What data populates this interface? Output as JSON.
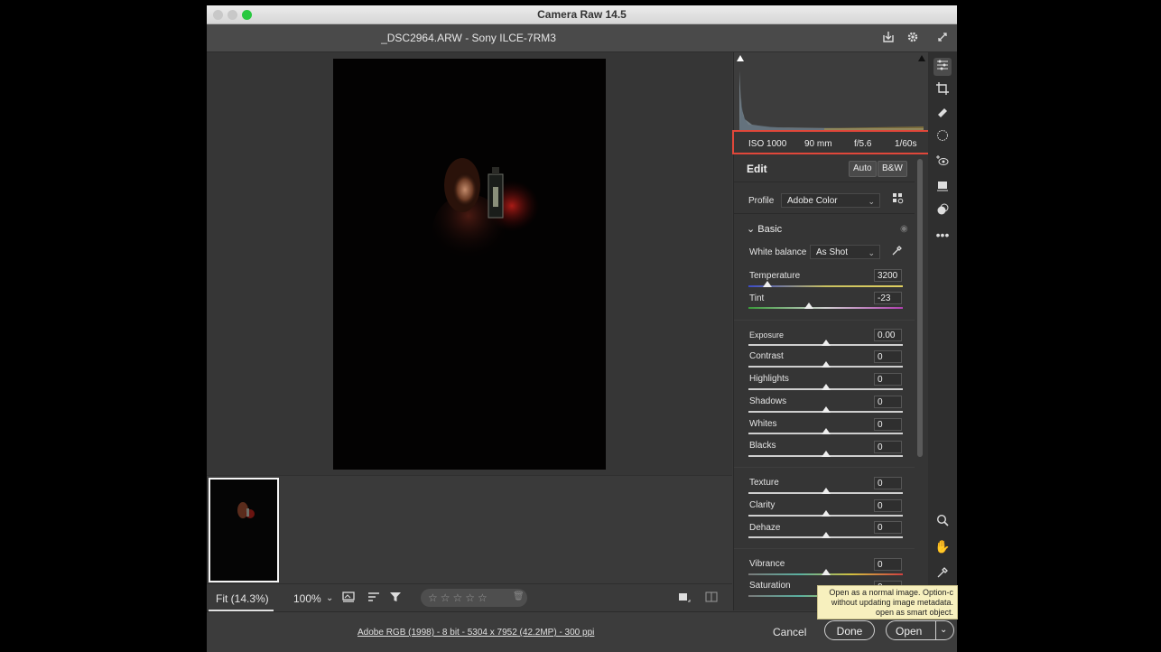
{
  "app": {
    "window_title": "Camera Raw 14.5"
  },
  "file": {
    "title": "_DSC2964.ARW  -  Sony ILCE-7RM3"
  },
  "exif": {
    "iso": "ISO 1000",
    "focal": "90 mm",
    "aperture": "f/5.6",
    "shutter": "1/60s"
  },
  "edit": {
    "title": "Edit",
    "auto_label": "Auto",
    "bw_label": "B&W",
    "profile_label": "Profile",
    "profile_value": "Adobe Color"
  },
  "basic": {
    "title": "Basic",
    "white_balance_label": "White balance",
    "white_balance_value": "As Shot",
    "temperature": {
      "label": "Temperature",
      "value": "3200"
    },
    "tint": {
      "label": "Tint",
      "value": "-23"
    },
    "exposure": {
      "label": "Exposure",
      "value": "0.00"
    },
    "contrast": {
      "label": "Contrast",
      "value": "0"
    },
    "highlights": {
      "label": "Highlights",
      "value": "0"
    },
    "shadows": {
      "label": "Shadows",
      "value": "0"
    },
    "whites": {
      "label": "Whites",
      "value": "0"
    },
    "blacks": {
      "label": "Blacks",
      "value": "0"
    },
    "texture": {
      "label": "Texture",
      "value": "0"
    },
    "clarity": {
      "label": "Clarity",
      "value": "0"
    },
    "dehaze": {
      "label": "Dehaze",
      "value": "0"
    },
    "vibrance": {
      "label": "Vibrance",
      "value": "0"
    },
    "saturation": {
      "label": "Saturation",
      "value": "0"
    }
  },
  "bottom": {
    "fit_label": "Fit (14.3%)",
    "zoom_label": "100%",
    "stars": "☆☆☆☆☆"
  },
  "footer": {
    "workflow_link": "Adobe RGB (1998) - 8 bit - 5304 x 7952 (42.2MP) - 300 ppi",
    "cancel_label": "Cancel",
    "done_label": "Done",
    "open_label": "Open"
  },
  "tooltip": {
    "line1": "Open as a normal image. Option-c",
    "line2": "without updating image metadata.",
    "line3": "open as smart object."
  },
  "colors": {
    "exif_highlight": "#e0473a",
    "accent": "#f7f0be"
  }
}
